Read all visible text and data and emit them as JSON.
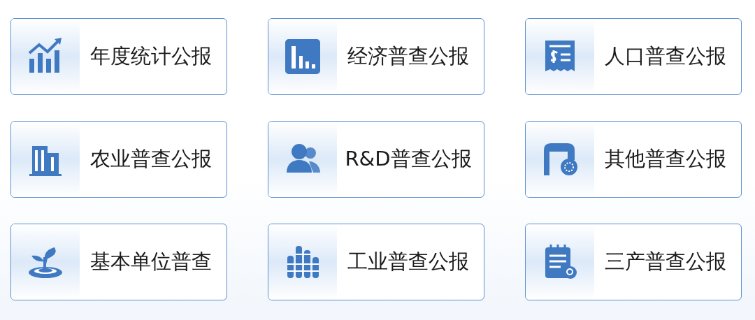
{
  "cards": [
    {
      "label": "年度统计公报",
      "kind": "chart"
    },
    {
      "label": "经济普查公报",
      "kind": "bars"
    },
    {
      "label": "人口普查公报",
      "kind": "receipt"
    },
    {
      "label": "农业普查公报",
      "kind": "building"
    },
    {
      "label": "R&D普查公报",
      "kind": "people"
    },
    {
      "label": "其他普查公报",
      "kind": "machine"
    },
    {
      "label": "基本单位普查",
      "kind": "sprout"
    },
    {
      "label": "工业普查公报",
      "kind": "columns"
    },
    {
      "label": "三产普查公报",
      "kind": "notepad"
    }
  ]
}
